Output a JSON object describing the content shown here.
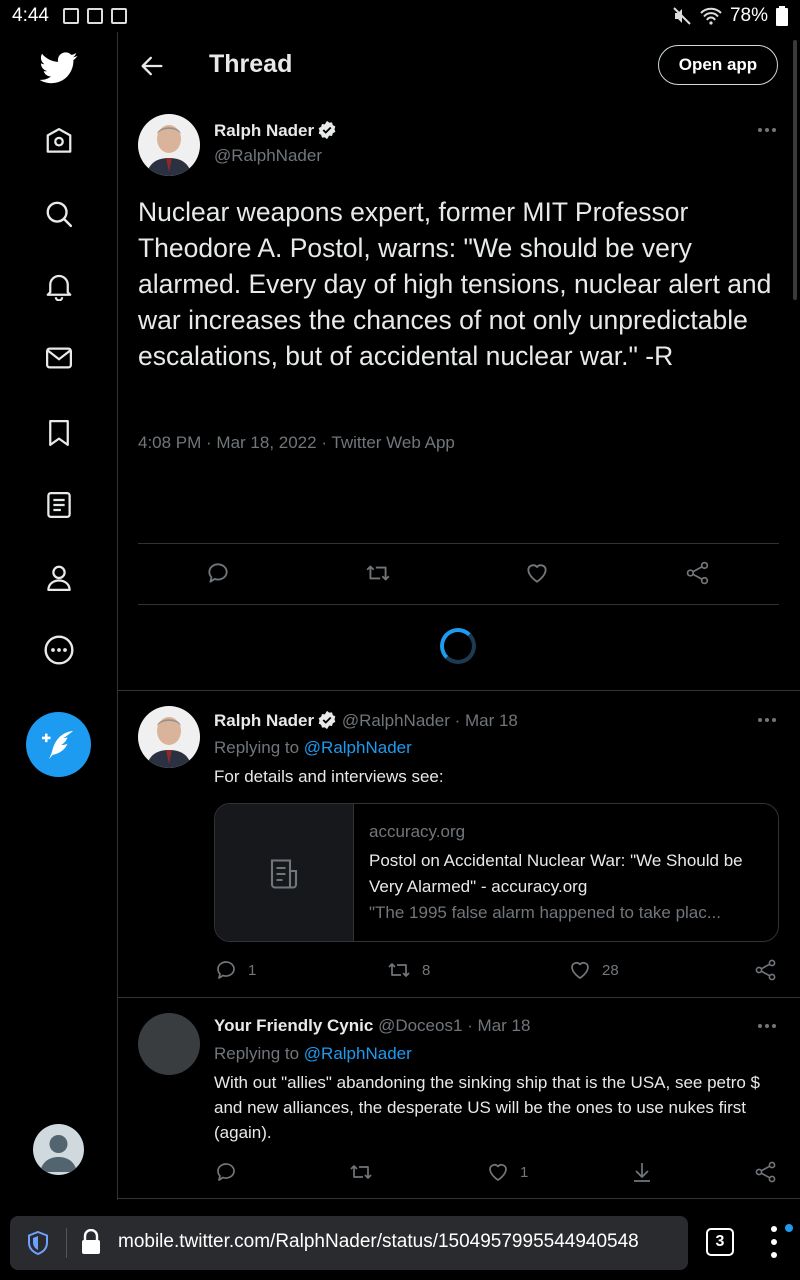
{
  "status_bar": {
    "time": "4:44",
    "battery": "78%"
  },
  "sidebar": {
    "items": [
      {
        "name": "home",
        "icon": "home-icon"
      },
      {
        "name": "explore",
        "icon": "search-icon"
      },
      {
        "name": "notifications",
        "icon": "bell-icon"
      },
      {
        "name": "messages",
        "icon": "mail-icon"
      },
      {
        "name": "bookmarks",
        "icon": "bookmark-icon"
      },
      {
        "name": "lists",
        "icon": "list-icon"
      },
      {
        "name": "profile",
        "icon": "person-icon"
      },
      {
        "name": "more",
        "icon": "more-circle-icon"
      }
    ],
    "compose_icon": "compose-feather-icon"
  },
  "header": {
    "title": "Thread",
    "open_app": "Open app"
  },
  "main_tweet": {
    "name": "Ralph Nader",
    "handle": "@RalphNader",
    "text": "Nuclear weapons expert, former MIT Professor Theodore A. Postol, warns: \"We should be very alarmed. Every day of high tensions, nuclear alert and war increases the chances of not only unpredictable escalations, but of accidental nuclear war.\" -R",
    "meta": "4:08 PM · Mar 18, 2022 · Twitter Web App"
  },
  "replies": [
    {
      "name": "Ralph Nader",
      "handle": "@RalphNader",
      "date": "· Mar 18",
      "replying_prefix": "Replying to ",
      "replying_to": "@RalphNader",
      "text": "For details and interviews see:",
      "card": {
        "domain": "accuracy.org",
        "title": "Postol on Accidental Nuclear War: \"We Should be Very Alarmed\" - accuracy.org",
        "description": "\"The 1995 false alarm happened to take plac..."
      },
      "reply_count": "1",
      "retweet_count": "8",
      "like_count": "28"
    },
    {
      "name": "Your Friendly Cynic",
      "handle": "@Doceos1",
      "date": "· Mar 18",
      "replying_prefix": "Replying to ",
      "replying_to": "@RalphNader",
      "text": "With out \"allies\" abandoning the sinking ship that is the USA, see petro $ and new alliances, the desperate US will be the ones to use nukes first (again).",
      "like_count": "1"
    }
  ],
  "browser": {
    "url": "mobile.twitter.com/RalphNader/status/1504957995544940548",
    "tab_count": "3"
  },
  "colors": {
    "accent": "#1d9bf0",
    "background": "#000000",
    "muted": "#71767b",
    "border": "#2f3336"
  }
}
